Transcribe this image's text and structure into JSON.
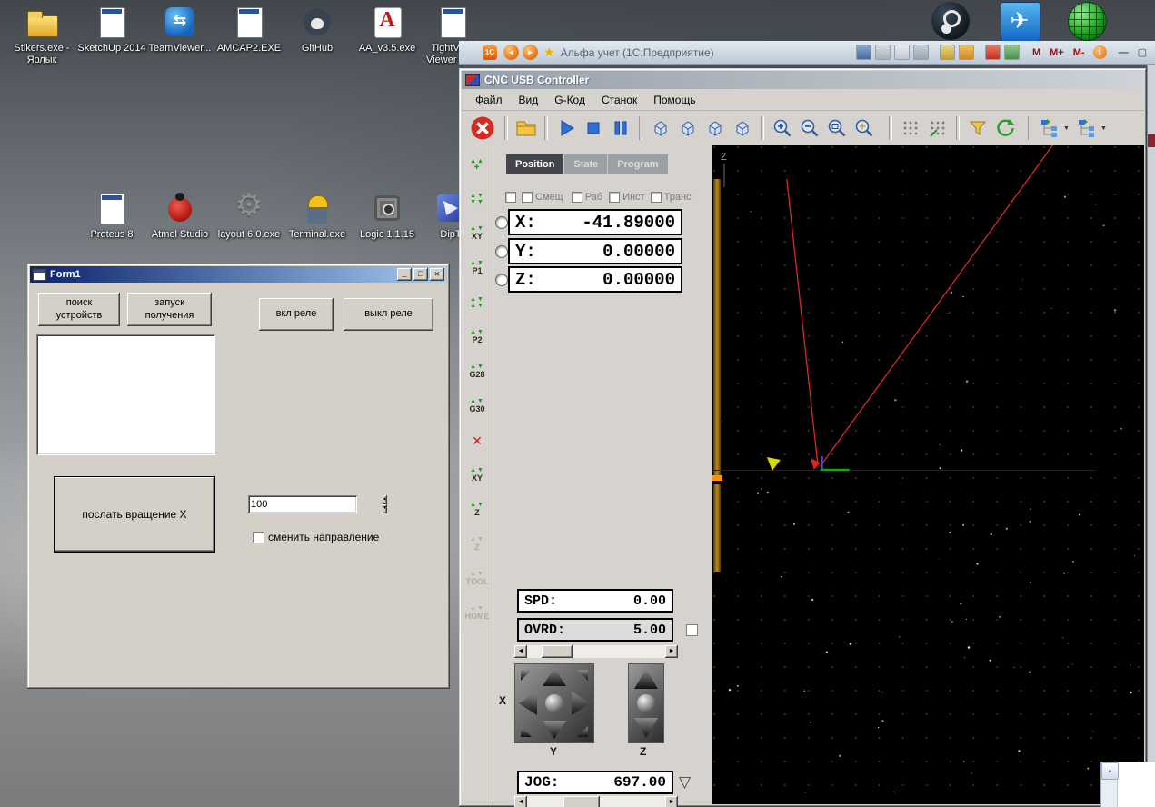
{
  "desktop": {
    "row1": [
      {
        "label": "Stikers.exe -\nЯрлык"
      },
      {
        "label": "SketchUp 2014"
      },
      {
        "label": "TeamViewer..."
      },
      {
        "label": "AMCAP2.EXE"
      },
      {
        "label": "GitHub"
      },
      {
        "label": "AA_v3.5.exe"
      },
      {
        "label": "TightVNC\nViewer pa..."
      }
    ],
    "row2": [
      {
        "label": "Proteus 8"
      },
      {
        "label": "Atmel Studio"
      },
      {
        "label": "layout 6.0.exe"
      },
      {
        "label": "Terminal.exe"
      },
      {
        "label": "Logic 1.1.15"
      },
      {
        "label": "DipT"
      }
    ]
  },
  "onec": {
    "title": "Альфа учет (1С:Предприятие)",
    "m": "M",
    "m_plus": "M+",
    "m_minus": "M-"
  },
  "form1": {
    "title": "Form1",
    "btn_search": "поиск\nустройств",
    "btn_start": "запуск\nполучения",
    "btn_relay_on": "вкл реле",
    "btn_relay_off": "выкл реле",
    "btn_rotate": "послать вращение X",
    "spin_value": "100",
    "chk_direction": "сменить направление"
  },
  "cnc": {
    "title": "CNC USB Controller",
    "menu": [
      "Файл",
      "Вид",
      "G-Код",
      "Станок",
      "Помощь"
    ],
    "tabs": [
      "Position",
      "State",
      "Program"
    ],
    "flags": [
      "Смещ",
      "Раб",
      "Инст",
      "Транс"
    ],
    "axes": [
      {
        "label": "X:",
        "value": "-41.89000"
      },
      {
        "label": "Y:",
        "value": "0.00000"
      },
      {
        "label": "Z:",
        "value": "0.00000"
      }
    ],
    "spd_label": "SPD:",
    "spd_value": "0.00",
    "ovrd_label": "OVRD:",
    "ovrd_value": "5.00",
    "jog_label": "JOG:",
    "jog_value": "697.00",
    "pad_x": "X",
    "pad_y": "Y",
    "pad_z": "Z",
    "side_labels": [
      "XY",
      "P1",
      "P2",
      "G28",
      "G30",
      "XY",
      "Z",
      "Z",
      "TOOL",
      "HOME"
    ],
    "viewport": {
      "z_label": "Z",
      "bg": "#000000",
      "path_color": "#d42a2a",
      "axis_colors": {
        "x": "#00b400",
        "y": "#e42020",
        "z": "#4848e8"
      }
    }
  }
}
